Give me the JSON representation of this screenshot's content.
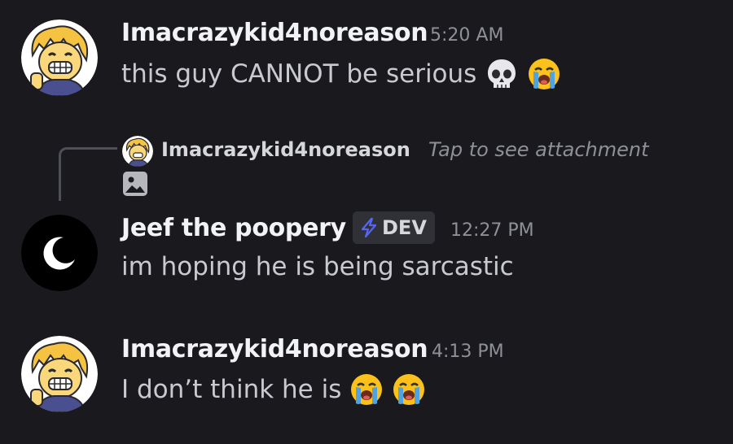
{
  "messages": [
    {
      "username": "Imacrazykid4noreason",
      "timestamp": "5:20 AM",
      "text": "this guy CANNOT be serious",
      "emojis": [
        "skull-emoji",
        "loudly-crying-emoji"
      ]
    },
    {
      "reply": {
        "username": "Imacrazykid4noreason",
        "preview": "Tap to see attachment",
        "icon": "image-attachment-icon"
      },
      "username": "Jeef the poopery",
      "tag": "DEV",
      "timestamp": "12:27 PM",
      "text": "im hoping he is being sarcastic"
    },
    {
      "username": "Imacrazykid4noreason",
      "timestamp": "4:13 PM",
      "text": "I don’t think he is",
      "emojis": [
        "loudly-crying-emoji",
        "loudly-crying-emoji"
      ]
    }
  ],
  "colors": {
    "background": "#1a1a1e",
    "username": "#f2f3f5",
    "text": "#c9cad0",
    "timestamp": "#8e9097",
    "tag_bolt": "#5865f2"
  }
}
